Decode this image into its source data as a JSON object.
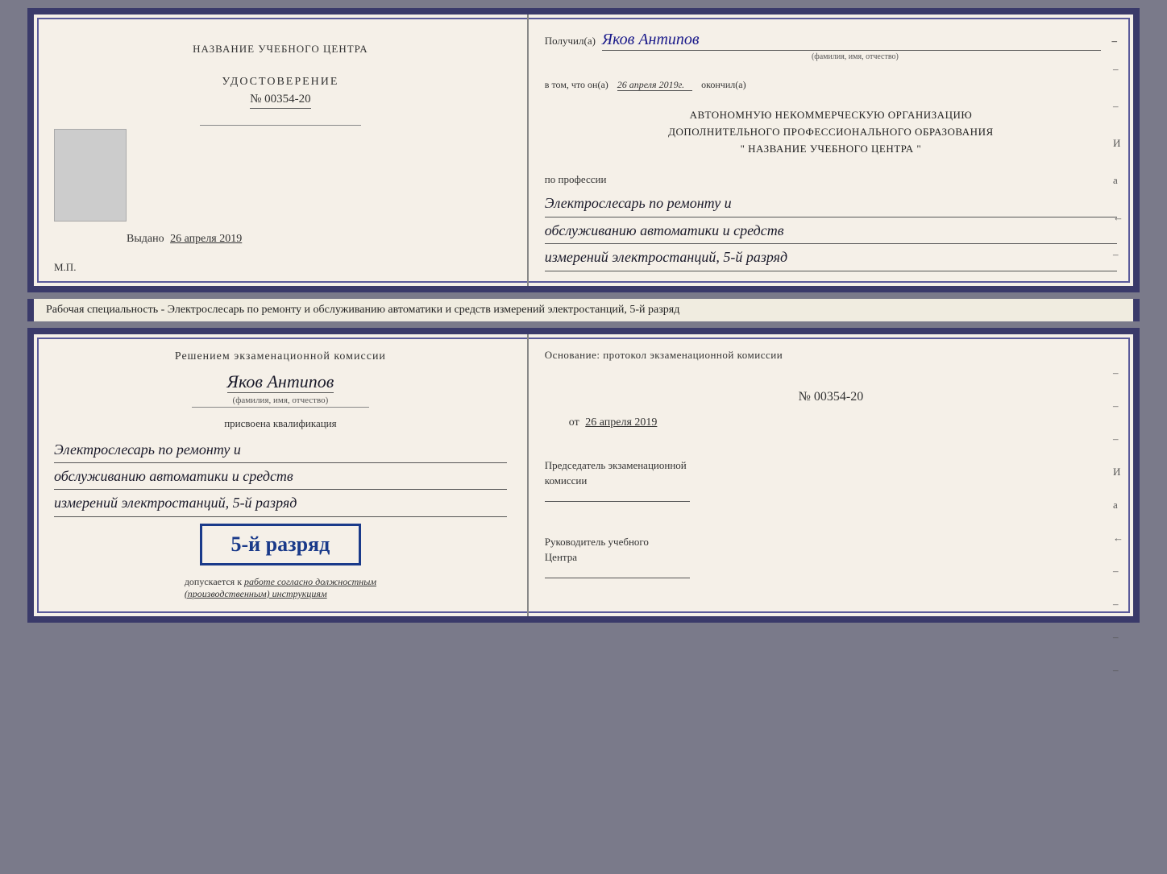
{
  "top_doc": {
    "left": {
      "center_name": "НАЗВАНИЕ УЧЕБНОГО ЦЕНТРА",
      "udostoverenie_title": "УДОСТОВЕРЕНИЕ",
      "udostoverenie_number": "№ 00354-20",
      "vydano_label": "Выдано",
      "vydano_date": "26 апреля 2019",
      "mp_label": "М.П."
    },
    "right": {
      "recipient_label": "Получил(а)",
      "recipient_name": "Яков Антипов",
      "fio_label": "(фамилия, имя, отчество)",
      "cert_text_prefix": "в том, что он(а)",
      "cert_date": "26 апреля 2019г.",
      "cert_text_suffix": "окончил(а)",
      "org_line1": "АВТОНОМНУЮ НЕКОММЕРЧЕСКУЮ ОРГАНИЗАЦИЮ",
      "org_line2": "ДОПОЛНИТЕЛЬНОГО ПРОФЕССИОНАЛЬНОГО ОБРАЗОВАНИЯ",
      "org_line3": "\"   НАЗВАНИЕ УЧЕБНОГО ЦЕНТРА   \"",
      "profession_label": "по профессии",
      "profession_line1": "Электрослесарь по ремонту и",
      "profession_line2": "обслуживанию автоматики и средств",
      "profession_line3": "измерений электростанций, 5-й разряд"
    }
  },
  "description": {
    "text": "Рабочая специальность - Электрослесарь по ремонту и обслуживанию автоматики и средств измерений электростанций, 5-й разряд"
  },
  "bottom_doc": {
    "left": {
      "decision_title": "Решением  экзаменационной  комиссии",
      "decision_name": "Яков Антипов",
      "fio_small": "(фамилия, имя, отчество)",
      "prisvoena": "присвоена квалификация",
      "qual_line1": "Электрослесарь по ремонту и",
      "qual_line2": "обслуживанию автоматики и средств",
      "qual_line3": "измерений электростанций, 5-й разряд",
      "rank_badge": "5-й разряд",
      "dopuskaetsya_prefix": "допускается к",
      "dopuskaetsya_italic": "работе согласно должностным",
      "dopuskaetsya_italic2": "(производственным) инструкциям"
    },
    "right": {
      "osnovaniye": "Основание:  протокол  экзаменационной  комиссии",
      "protocol_number": "№  00354-20",
      "protocol_date_prefix": "от",
      "protocol_date": "26 апреля 2019",
      "chairman_title": "Председатель экзаменационной",
      "chairman_title2": "комиссии",
      "rukovoditel_title": "Руководитель учебного",
      "rukovoditel_title2": "Центра"
    }
  },
  "side_labels": {
    "i": "И",
    "a": "а",
    "arrow": "←",
    "dash1": "–",
    "dash2": "–",
    "dash3": "–",
    "dash4": "–",
    "dash5": "–"
  }
}
